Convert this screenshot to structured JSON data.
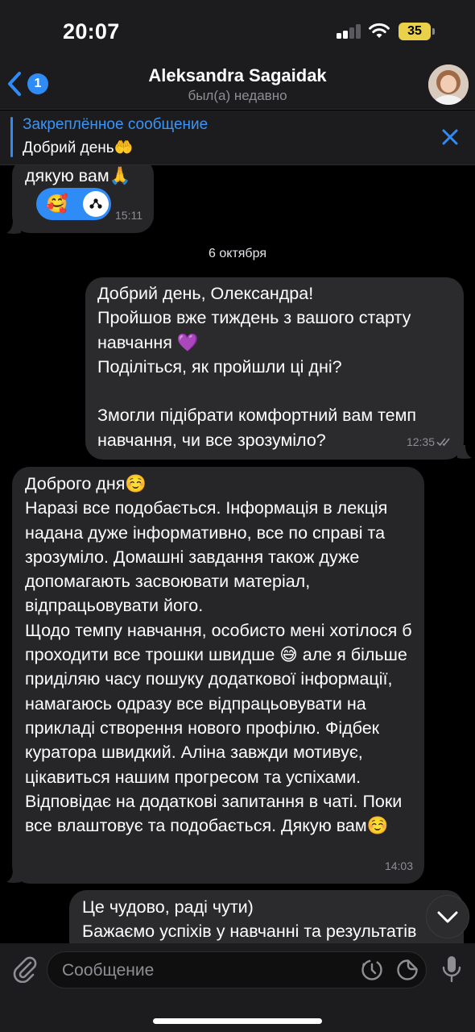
{
  "status_bar": {
    "time": "20:07",
    "battery": "35"
  },
  "header": {
    "back_badge": "1",
    "contact_name": "Aleksandra Sagaidak",
    "contact_status": "был(а) недавно"
  },
  "pinned": {
    "title": "Закреплённое сообщение",
    "text": "Добрий день🤲"
  },
  "messages": [
    {
      "direction": "incoming",
      "text": "дякую вам🙏",
      "time": "15:11",
      "reaction": "🥰"
    },
    {
      "type": "date",
      "text": "6 октября"
    },
    {
      "direction": "outgoing",
      "text": "Добрий день, Олександра!\nПройшов вже тиждень з вашого старту навчання 💜\nПоділіться, як пройшли ці дні?\n\nЗмогли підібрати комфортний вам темп навчання, чи все зрозуміло?",
      "time": "12:35"
    },
    {
      "direction": "incoming",
      "text": "Доброго дня☺️\nНаразі все подобається. Інформація в лекція надана дуже інформативно, все по справі та зрозуміло. Домашні завдання також дуже допомагають засвоювати матеріал, відпрацьовувати його.\nЩодо темпу навчання, особисто мені хотілося б проходити все трошки швидше 😅 але я більше приділяю часу пошуку додаткової інформації, намагаюсь одразу все відпрацьовувати на прикладі створення нового профілю. Фідбек куратора швидкий. Аліна завжди мотивує, цікавиться нашим прогресом та успіхами. Відповідає на додаткові запитання в чаті. Поки все влаштовує та подобається. Дякую вам☺️",
      "time": "14:03"
    },
    {
      "direction": "outgoing",
      "text": "Це чудово, раді чути)\nБажаємо успіхів у навчанні та результатів"
    }
  ],
  "input": {
    "placeholder": "Сообщение"
  },
  "icons": {
    "back": "chevron-left-icon",
    "close": "close-icon",
    "attach": "paperclip-icon",
    "timer": "timer-icon",
    "sticker": "sticker-icon",
    "mic": "microphone-icon",
    "scroll_down": "chevron-down-icon"
  },
  "colors": {
    "accent": "#2f8cf6",
    "bubble_incoming": "#262628",
    "bubble_outgoing": "#2b2b2d",
    "bar_background": "#1c1c1e",
    "battery": "#e9d24a"
  }
}
